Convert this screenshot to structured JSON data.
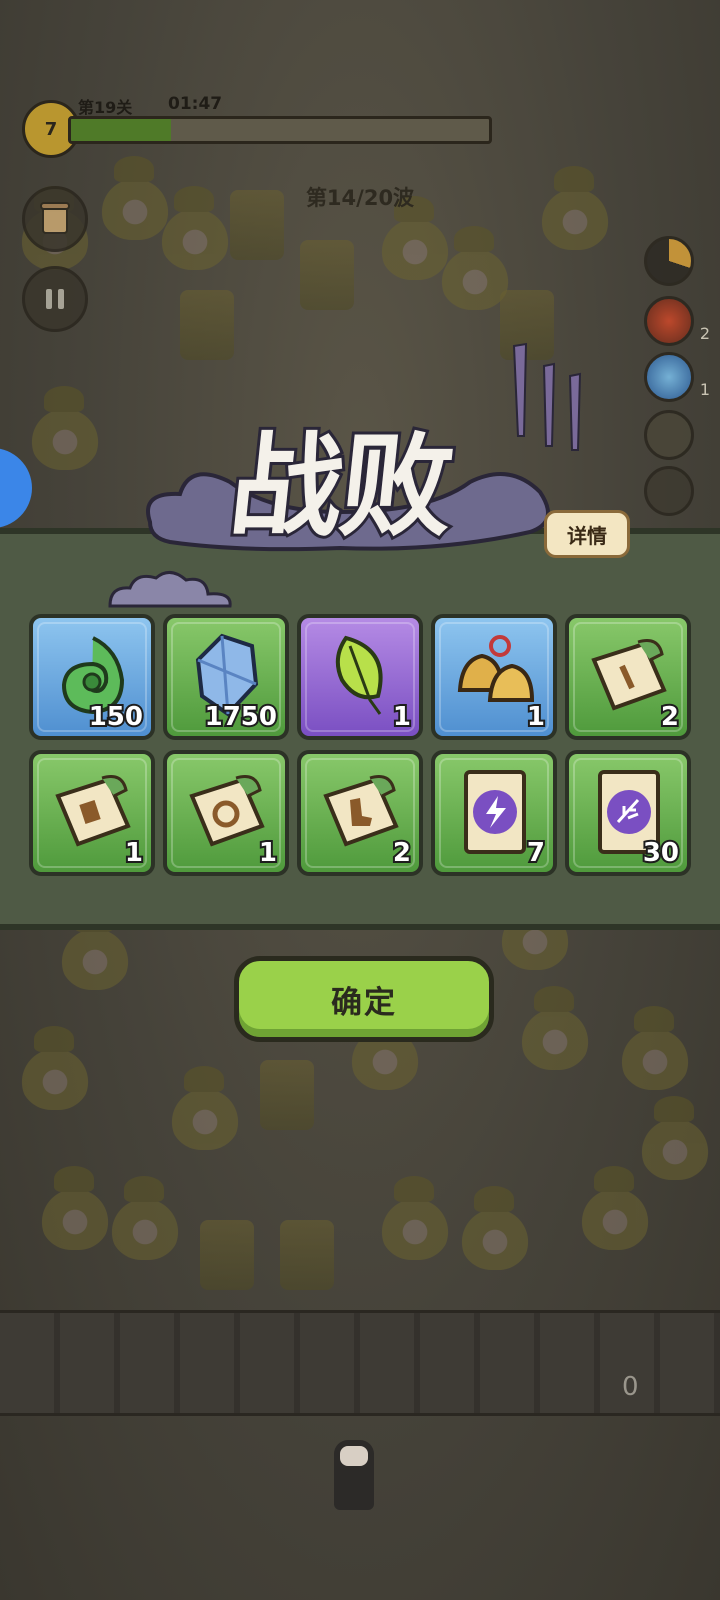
{
  "hud": {
    "level_badge": "7",
    "stage_label": "第19关",
    "timer": "01:47",
    "progress_fraction": 0.24,
    "wave_label": "第14/20波"
  },
  "side_skills": [
    {
      "name": "skill-slot-1",
      "count": ""
    },
    {
      "name": "skill-slot-2",
      "count": "2"
    },
    {
      "name": "skill-slot-3",
      "count": "1"
    },
    {
      "name": "skill-slot-4",
      "count": ""
    },
    {
      "name": "skill-slot-5",
      "count": ""
    }
  ],
  "result": {
    "title": "战败",
    "detail_label": "详情",
    "confirm_label": "确定"
  },
  "rewards": [
    {
      "icon": "jade-swirl-icon",
      "rarity": "blue",
      "qty": "150"
    },
    {
      "icon": "crystal-shard-icon",
      "rarity": "green",
      "qty": "1750"
    },
    {
      "icon": "leaf-sprout-icon",
      "rarity": "purple",
      "qty": "1"
    },
    {
      "icon": "golden-bells-icon",
      "rarity": "blue",
      "qty": "1"
    },
    {
      "icon": "sword-scroll-icon",
      "rarity": "green",
      "qty": "2"
    },
    {
      "icon": "armor-scroll-icon",
      "rarity": "green",
      "qty": "1"
    },
    {
      "icon": "ring-scroll-icon",
      "rarity": "green",
      "qty": "1"
    },
    {
      "icon": "boot-scroll-icon",
      "rarity": "green",
      "qty": "2"
    },
    {
      "icon": "lightning-scroll-icon",
      "rarity": "green",
      "qty": "7"
    },
    {
      "icon": "feather-scroll-icon",
      "rarity": "green",
      "qty": "30"
    }
  ],
  "ground": {
    "counter": "0"
  },
  "colors": {
    "confirm": "#9ad14a",
    "blue_slot": "#4f8fd0",
    "green_slot": "#4f9a3c",
    "purple_slot": "#7a4fc2"
  }
}
